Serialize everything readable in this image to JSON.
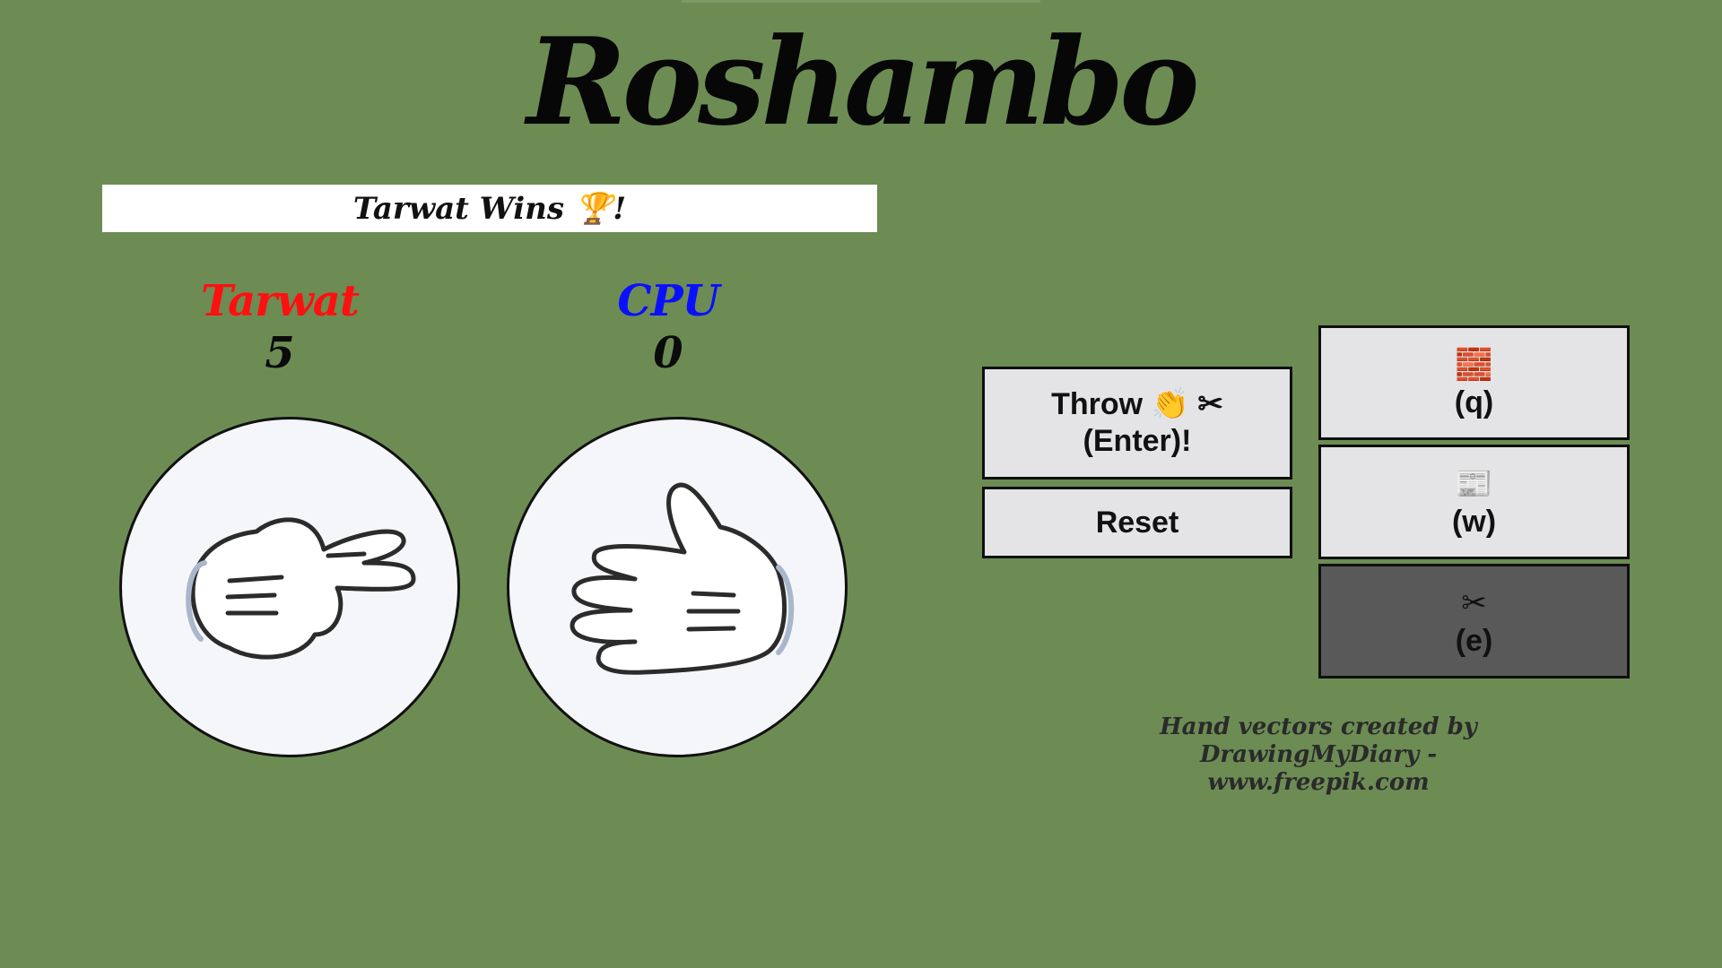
{
  "title": "Roshambo",
  "result": {
    "text": "Tarwat Wins 🏆!"
  },
  "players": {
    "player": {
      "name": "Tarwat",
      "score": "5",
      "color": "#ff1010",
      "hand": "scissors"
    },
    "cpu": {
      "name": "CPU",
      "score": "0",
      "color": "#0a10ff",
      "hand": "paper"
    }
  },
  "controls": {
    "throw_line1": "Throw 👏 ✂",
    "throw_line2": "(Enter)!",
    "reset_label": "Reset"
  },
  "choices": [
    {
      "name": "rock",
      "icon": "🧱",
      "key": "(q)",
      "selected": false
    },
    {
      "name": "paper",
      "icon": "📰",
      "key": "(w)",
      "selected": false
    },
    {
      "name": "scissors",
      "icon": "✂",
      "key": "(e)",
      "selected": true
    }
  ],
  "credit": {
    "line1": "Hand vectors created by DrawingMyDiary -",
    "line2": "www.freepik.com"
  },
  "colors": {
    "background": "#6c8c54",
    "button": "#e4e3e5",
    "selected_button": "#595959"
  }
}
